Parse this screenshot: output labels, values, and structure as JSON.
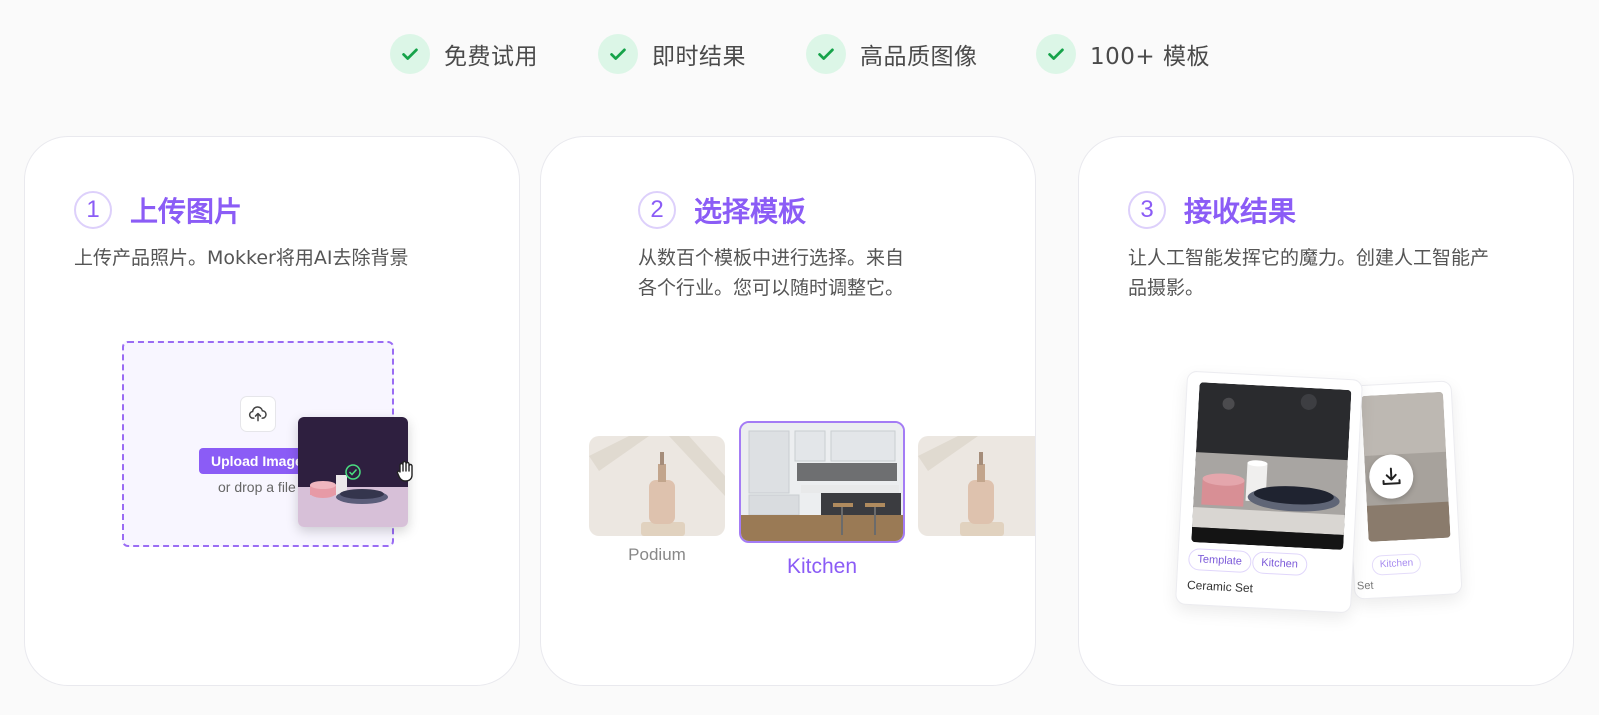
{
  "features": [
    {
      "label": "免费试用",
      "icon": "check-icon"
    },
    {
      "label": "即时结果",
      "icon": "check-icon"
    },
    {
      "label": "高品质图像",
      "icon": "check-icon"
    },
    {
      "label": "100+ 模板",
      "icon": "check-icon"
    }
  ],
  "colors": {
    "accent": "#8b5cf6",
    "check": "#16a34a",
    "check_bg": "#dcf6e7"
  },
  "steps": [
    {
      "number": "1",
      "title": "上传图片",
      "desc_lines": [
        "上传产品照片。Mokker将用AI去除背景"
      ],
      "upload": {
        "button_label": "Upload Image",
        "drop_text": "or drop a file"
      }
    },
    {
      "number": "2",
      "title": "选择模板",
      "desc_lines": [
        "从数百个模板中进行选择。来自",
        "各个行业。您可以随时调整它。"
      ],
      "templates": [
        {
          "label": "Podium"
        },
        {
          "label": "Kitchen",
          "selected": true
        }
      ]
    },
    {
      "number": "3",
      "title": "接收结果",
      "desc_lines": [
        "让人工智能发挥它的魔力。创建人工智能产",
        "品摄影。"
      ],
      "result": {
        "tags": [
          "Template",
          "Kitchen"
        ],
        "name": "Ceramic Set",
        "back_tag": "Kitchen",
        "back_name": "Set"
      }
    }
  ]
}
